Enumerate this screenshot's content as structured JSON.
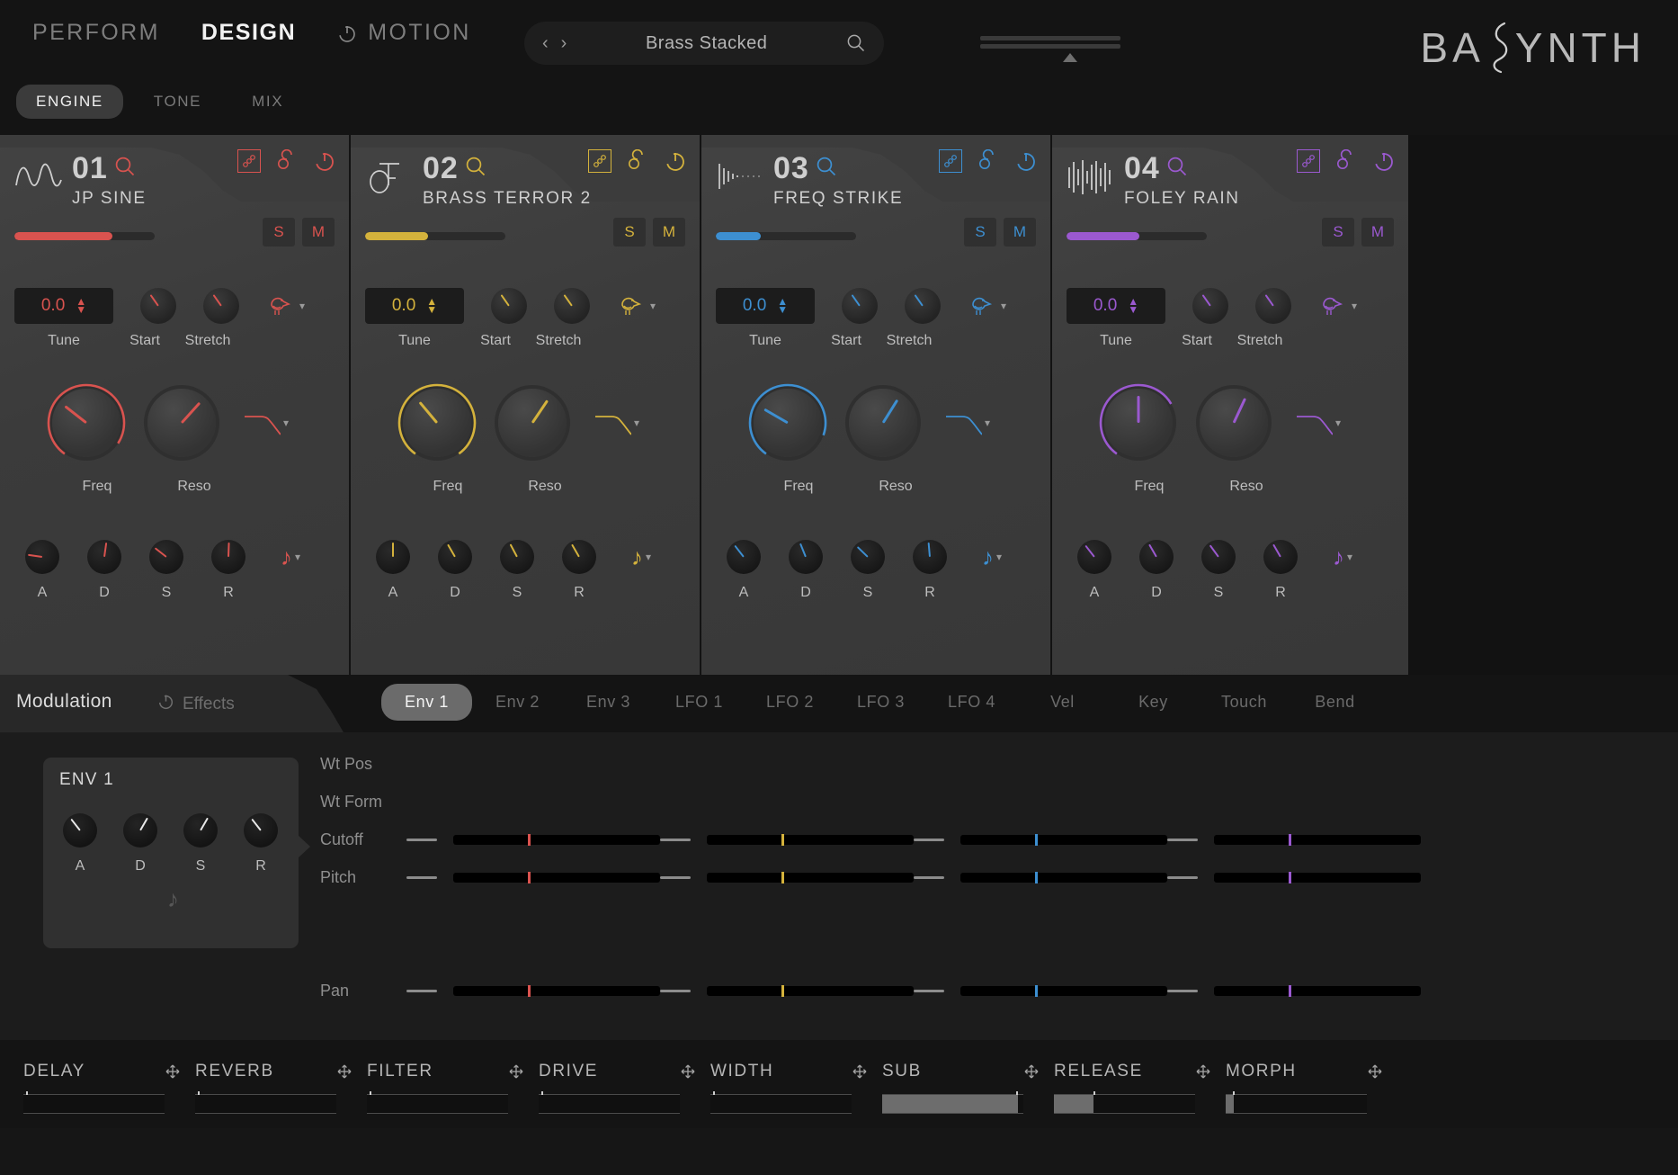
{
  "header": {
    "nav": [
      {
        "label": "PERFORM",
        "active": false,
        "has_power": false
      },
      {
        "label": "DESIGN",
        "active": true,
        "has_power": false
      },
      {
        "label": "MOTION",
        "active": false,
        "has_power": true
      }
    ],
    "subnav": [
      {
        "label": "ENGINE",
        "active": true
      },
      {
        "label": "TONE",
        "active": false
      },
      {
        "label": "MIX",
        "active": false
      }
    ],
    "preset": {
      "name": "Brass Stacked",
      "prev_icon": "chevron-left-icon",
      "next_icon": "chevron-right-icon",
      "search_icon": "search-icon"
    },
    "master_slider": {
      "value_pct": 59
    },
    "logo": "BASYNTH"
  },
  "engines": [
    {
      "number": "01",
      "name": "JP SINE",
      "color": "#d9534f",
      "waveform_icon": "sine-wave-icon",
      "search_icon": "search-icon",
      "link_box_icon": "modulation-chain-icon",
      "link_icon": "link-icon",
      "power_icon": "power-icon",
      "level_pct": 70,
      "solo_label": "S",
      "mute_label": "M",
      "tune_value": "0.0",
      "tune_label": "Tune",
      "start_label": "Start",
      "stretch_label": "Stretch",
      "start_angle": -35,
      "stretch_angle": -35,
      "source_icon": "bird-icon",
      "freq_label": "Freq",
      "reso_label": "Reso",
      "freq_angle": 128,
      "reso_angle": 222,
      "freq_arc_pct": 74,
      "filter_curve_icon": "lowpass-curve-icon",
      "adsr_labels": [
        "A",
        "D",
        "S",
        "R"
      ],
      "adsr_angles": [
        -82,
        8,
        -52,
        2
      ],
      "note_icon": "music-note-icon"
    },
    {
      "number": "02",
      "name": "BRASS TERROR 2",
      "color": "#d4b23c",
      "waveform_icon": "horn-icon",
      "search_icon": "search-icon",
      "link_box_icon": "modulation-chain-icon",
      "link_icon": "link-icon",
      "power_icon": "power-icon",
      "level_pct": 45,
      "solo_label": "S",
      "mute_label": "M",
      "tune_value": "0.0",
      "tune_label": "Tune",
      "start_label": "Start",
      "stretch_label": "Stretch",
      "start_angle": -35,
      "stretch_angle": -35,
      "source_icon": "bird-icon",
      "freq_label": "Freq",
      "reso_label": "Reso",
      "freq_angle": 140,
      "reso_angle": 214,
      "freq_arc_pct": 80,
      "filter_curve_icon": "lowpass-curve-icon",
      "adsr_labels": [
        "A",
        "D",
        "S",
        "R"
      ],
      "adsr_angles": [
        0,
        -30,
        -28,
        -30
      ],
      "note_icon": "music-note-icon"
    },
    {
      "number": "03",
      "name": "FREQ STRIKE",
      "color": "#3d8fd1",
      "waveform_icon": "impulse-icon",
      "search_icon": "search-icon",
      "link_box_icon": "modulation-chain-icon",
      "link_icon": "link-icon",
      "power_icon": "power-icon",
      "level_pct": 32,
      "solo_label": "S",
      "mute_label": "M",
      "tune_value": "0.0",
      "tune_label": "Tune",
      "start_label": "Start",
      "stretch_label": "Stretch",
      "start_angle": -35,
      "stretch_angle": -35,
      "source_icon": "bird-icon",
      "freq_label": "Freq",
      "reso_label": "Reso",
      "freq_angle": 120,
      "reso_angle": 212,
      "freq_arc_pct": 70,
      "filter_curve_icon": "lowpass-curve-icon",
      "adsr_labels": [
        "A",
        "D",
        "S",
        "R"
      ],
      "adsr_angles": [
        -38,
        -22,
        -46,
        -5
      ],
      "note_icon": "music-note-icon"
    },
    {
      "number": "04",
      "name": "FOLEY RAIN",
      "color": "#9b59d0",
      "waveform_icon": "noise-icon",
      "search_icon": "search-icon",
      "link_box_icon": "modulation-chain-icon",
      "link_icon": "link-icon",
      "power_icon": "power-icon",
      "level_pct": 52,
      "solo_label": "S",
      "mute_label": "M",
      "tune_value": "0.0",
      "tune_label": "Tune",
      "start_label": "Start",
      "stretch_label": "Stretch",
      "start_angle": -35,
      "stretch_angle": -35,
      "source_icon": "bird-icon",
      "freq_label": "Freq",
      "reso_label": "Reso",
      "freq_angle": 180,
      "reso_angle": 205,
      "freq_arc_pct": 55,
      "filter_curve_icon": "lowpass-curve-icon",
      "adsr_labels": [
        "A",
        "D",
        "S",
        "R"
      ],
      "adsr_angles": [
        -38,
        -30,
        -36,
        -30
      ],
      "note_icon": "music-note-icon"
    }
  ],
  "modulation": {
    "section_label": "Modulation",
    "effects_label": "Effects",
    "effects_power_icon": "power-icon",
    "tabs": [
      {
        "label": "Env 1",
        "active": true
      },
      {
        "label": "Env 2",
        "active": false
      },
      {
        "label": "Env 3",
        "active": false
      },
      {
        "label": "LFO 1",
        "active": false
      },
      {
        "label": "LFO 2",
        "active": false
      },
      {
        "label": "LFO 3",
        "active": false
      },
      {
        "label": "LFO 4",
        "active": false
      },
      {
        "label": "Vel",
        "active": false
      },
      {
        "label": "Key",
        "active": false
      },
      {
        "label": "Touch",
        "active": false
      },
      {
        "label": "Bend",
        "active": false
      }
    ],
    "env_card": {
      "title": "ENV 1",
      "knob_labels": [
        "A",
        "D",
        "S",
        "R"
      ],
      "knob_angles": [
        -38,
        30,
        30,
        -38
      ],
      "note_icon": "music-note-icon"
    },
    "matrix": {
      "rows": [
        {
          "label": "Wt Pos",
          "has_sliders": false
        },
        {
          "label": "Wt Form",
          "has_sliders": false
        },
        {
          "label": "Cutoff",
          "has_sliders": true,
          "positions": [
            36,
            36,
            36,
            36
          ]
        },
        {
          "label": "Pitch",
          "has_sliders": true,
          "positions": [
            36,
            36,
            36,
            36
          ]
        },
        {
          "label": "",
          "has_sliders": false
        },
        {
          "label": "Pan",
          "has_sliders": true,
          "positions": [
            36,
            36,
            36,
            36
          ]
        }
      ]
    }
  },
  "macros": [
    {
      "label": "DELAY",
      "move_icon": "move-icon",
      "tick_pct": 2,
      "fill_pct": 0
    },
    {
      "label": "REVERB",
      "move_icon": "move-icon",
      "tick_pct": 2,
      "fill_pct": 0
    },
    {
      "label": "FILTER",
      "move_icon": "move-icon",
      "tick_pct": 2,
      "fill_pct": 0
    },
    {
      "label": "DRIVE",
      "move_icon": "move-icon",
      "tick_pct": 2,
      "fill_pct": 0
    },
    {
      "label": "WIDTH",
      "move_icon": "move-icon",
      "tick_pct": 2,
      "fill_pct": 0
    },
    {
      "label": "SUB",
      "move_icon": "move-icon",
      "tick_pct": 95,
      "fill_pct": 96
    },
    {
      "label": "RELEASE",
      "move_icon": "move-icon",
      "tick_pct": 28,
      "fill_pct": 28
    },
    {
      "label": "MORPH",
      "move_icon": "move-icon",
      "tick_pct": 5,
      "fill_pct": 6
    }
  ]
}
